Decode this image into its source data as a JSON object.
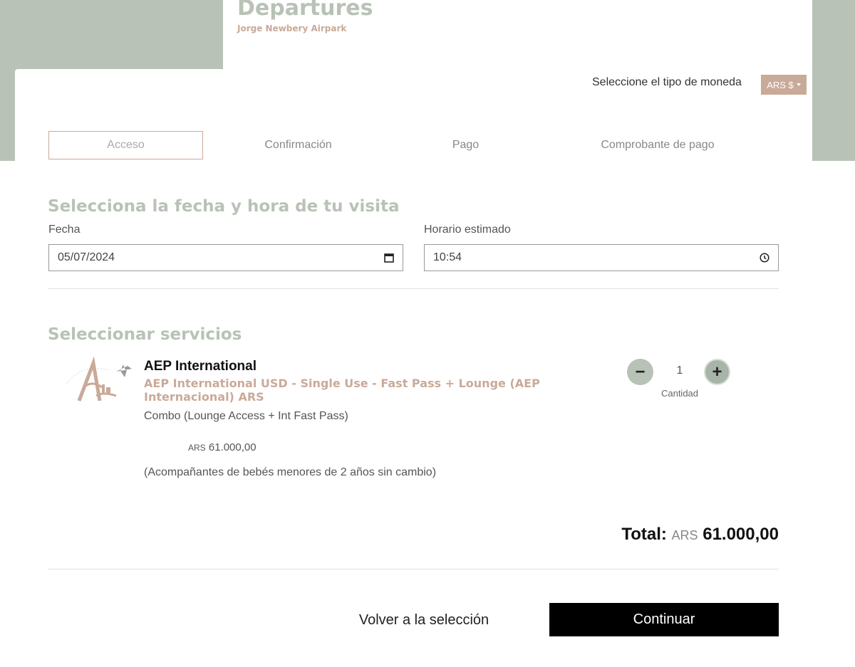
{
  "header": {
    "title": "Departures",
    "subtitle": "Jorge Newbery Airpark"
  },
  "currency": {
    "label": "Seleccione el tipo de moneda",
    "selected": "ARS $"
  },
  "steps": [
    {
      "label": "Acceso",
      "active": true
    },
    {
      "label": "Confirmación",
      "active": false
    },
    {
      "label": "Pago",
      "active": false
    },
    {
      "label": "Comprobante de pago",
      "active": false
    }
  ],
  "visit": {
    "title": "Selecciona la fecha y hora de tu visita",
    "date_label": "Fecha",
    "date_value": "05/07/2024",
    "time_label": "Horario estimado",
    "time_value": "10:54"
  },
  "services": {
    "title": "Seleccionar servicios",
    "items": [
      {
        "name": "AEP International",
        "description": "AEP International USD - Single Use - Fast Pass + Lounge (AEP Internacional) ARS",
        "combo": "Combo (Lounge Access + Int Fast Pass)",
        "price_currency": "ARS",
        "price_value": "61.000,00",
        "note": "(Acompañantes de bebés menores de 2 años sin cambio)",
        "quantity": "1",
        "quantity_label": "Cantidad",
        "minus_symbol": "−",
        "plus_symbol": "+"
      }
    ]
  },
  "total": {
    "label": "Total:",
    "currency": "ARS",
    "value": "61.000,00"
  },
  "actions": {
    "back": "Volver a la selección",
    "continue": "Continuar"
  },
  "colors": {
    "sage": "#b8c2b6",
    "tan": "#c9aa98",
    "black": "#000000"
  }
}
